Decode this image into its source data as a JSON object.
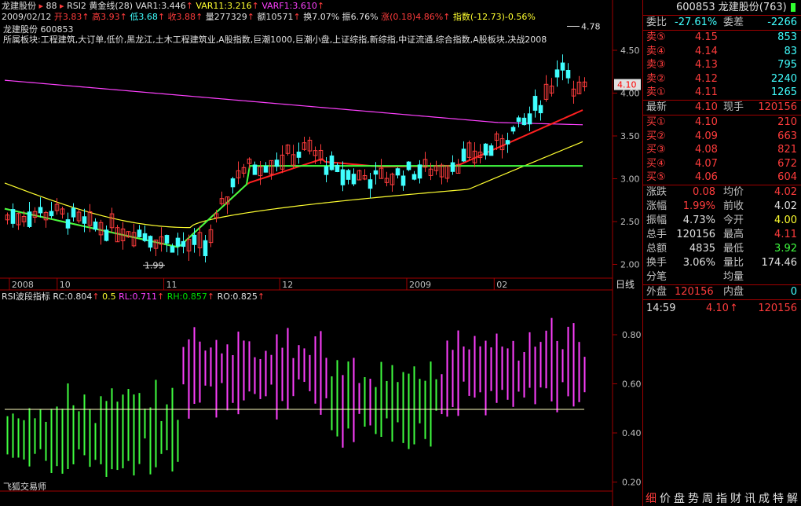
{
  "header": {
    "stock_name": "龙建股份",
    "marker_value": "88",
    "indicators": "RSI2 黄金线(28)",
    "var1": "VAR1:3.446",
    "var11": "VAR11:3.216",
    "varf1": "VARF1:3.610",
    "date": "2009/02/12",
    "open": "开3.83",
    "high": "高3.93",
    "low": "低3.68",
    "close": "收3.88",
    "volume": "量277329",
    "amount": "额10571",
    "turnover": "换7.07%",
    "amplitude": "振6.76%",
    "change": "涨(0.18)4.86%",
    "index_change": "指数(-12.73)-0.56%",
    "sectors": "所属板块:工程建筑,大订单,低价,黑龙江,土木工程建筑业,A股指数,巨潮1000,巨潮小盘,上证综指,新综指,中证流通,综合指数,A股板块,决战2008",
    "chart_title": "龙建股份 600853",
    "period_label": "日线"
  },
  "x_axis_labels": [
    {
      "text": "2008",
      "pos": 0.008
    },
    {
      "text": "10",
      "pos": 0.09
    },
    {
      "text": "11",
      "pos": 0.273
    },
    {
      "text": "12",
      "pos": 0.472
    },
    {
      "text": "2009",
      "pos": 0.69
    },
    {
      "text": "02",
      "pos": 0.84
    }
  ],
  "price_axis": [
    "4.50",
    "4.00",
    "3.50",
    "3.00",
    "2.50",
    "2.00"
  ],
  "price_annotations": {
    "high": "4.78",
    "low": "1.99",
    "current": "4.10"
  },
  "rsi": {
    "title": "RSI波段指标",
    "rc": "RC:0.804",
    "rc_mark": "0.5",
    "rl": "RL:0.711",
    "rh": "RH:0.857",
    "ro": "RO:0.825",
    "axis": [
      "0.80",
      "0.60",
      "0.40",
      "0.20"
    ],
    "footer": "飞狐交易师"
  },
  "panel": {
    "code_title": "600853 龙建股份(763)",
    "webi_label": "委比",
    "webi_value": "-27.61%",
    "weicha_label": "委差",
    "weicha_value": "-2266",
    "sells": [
      {
        "label": "卖⑤",
        "price": "4.15",
        "vol": "853"
      },
      {
        "label": "卖④",
        "price": "4.14",
        "vol": "83"
      },
      {
        "label": "卖③",
        "price": "4.13",
        "vol": "795"
      },
      {
        "label": "卖②",
        "price": "4.12",
        "vol": "2240"
      },
      {
        "label": "卖①",
        "price": "4.11",
        "vol": "1265"
      }
    ],
    "latest_label": "最新",
    "latest_value": "4.10",
    "xianshou_label": "现手",
    "xianshou_value": "120156",
    "buys": [
      {
        "label": "买①",
        "price": "4.10",
        "vol": "210"
      },
      {
        "label": "买②",
        "price": "4.09",
        "vol": "663"
      },
      {
        "label": "买③",
        "price": "4.08",
        "vol": "821"
      },
      {
        "label": "买④",
        "price": "4.07",
        "vol": "672"
      },
      {
        "label": "买⑤",
        "price": "4.06",
        "vol": "604"
      }
    ],
    "stats": [
      {
        "l1": "涨跌",
        "v1": "0.08",
        "c1": "#ff3c3c",
        "l2": "均价",
        "v2": "4.02",
        "c2": "#ff3c3c"
      },
      {
        "l1": "涨幅",
        "v1": "1.99%",
        "c1": "#ff3c3c",
        "l2": "前收",
        "v2": "4.02",
        "c2": "#e0e0e0"
      },
      {
        "l1": "振幅",
        "v1": "4.73%",
        "c1": "#e0e0e0",
        "l2": "今开",
        "v2": "4.00",
        "c2": "#ffff30"
      },
      {
        "l1": "总手",
        "v1": "120156",
        "c1": "#e0e0e0",
        "l2": "最高",
        "v2": "4.11",
        "c2": "#ff3c3c"
      },
      {
        "l1": "总额",
        "v1": "4835",
        "c1": "#e0e0e0",
        "l2": "最低",
        "v2": "3.92",
        "c2": "#40ff40"
      },
      {
        "l1": "换手",
        "v1": "3.06%",
        "c1": "#e0e0e0",
        "l2": "量比",
        "v2": "174.46",
        "c2": "#e0e0e0"
      },
      {
        "l1": "分笔",
        "v1": "",
        "c1": "#e0e0e0",
        "l2": "均量",
        "v2": "",
        "c2": "#e0e0e0"
      }
    ],
    "waipan_label": "外盘",
    "waipan_value": "120156",
    "neipan_label": "内盘",
    "neipan_value": "0",
    "tick_time": "14:59",
    "tick_price": "4.10",
    "tick_arrow": "↑",
    "tick_vol": "120156",
    "bottom_tabs": [
      "细",
      "价",
      "盘",
      "势",
      "周",
      "指",
      "财",
      "讯",
      "成",
      "特",
      "解"
    ]
  },
  "colors": {
    "up": "#ff3c3c",
    "down": "#40ffff",
    "ma_long": "#ff40ff",
    "ma_mid": "#ffff30",
    "ma_short": "#ff2020",
    "ma_green": "#40ff40",
    "frame": "#a00000"
  }
}
